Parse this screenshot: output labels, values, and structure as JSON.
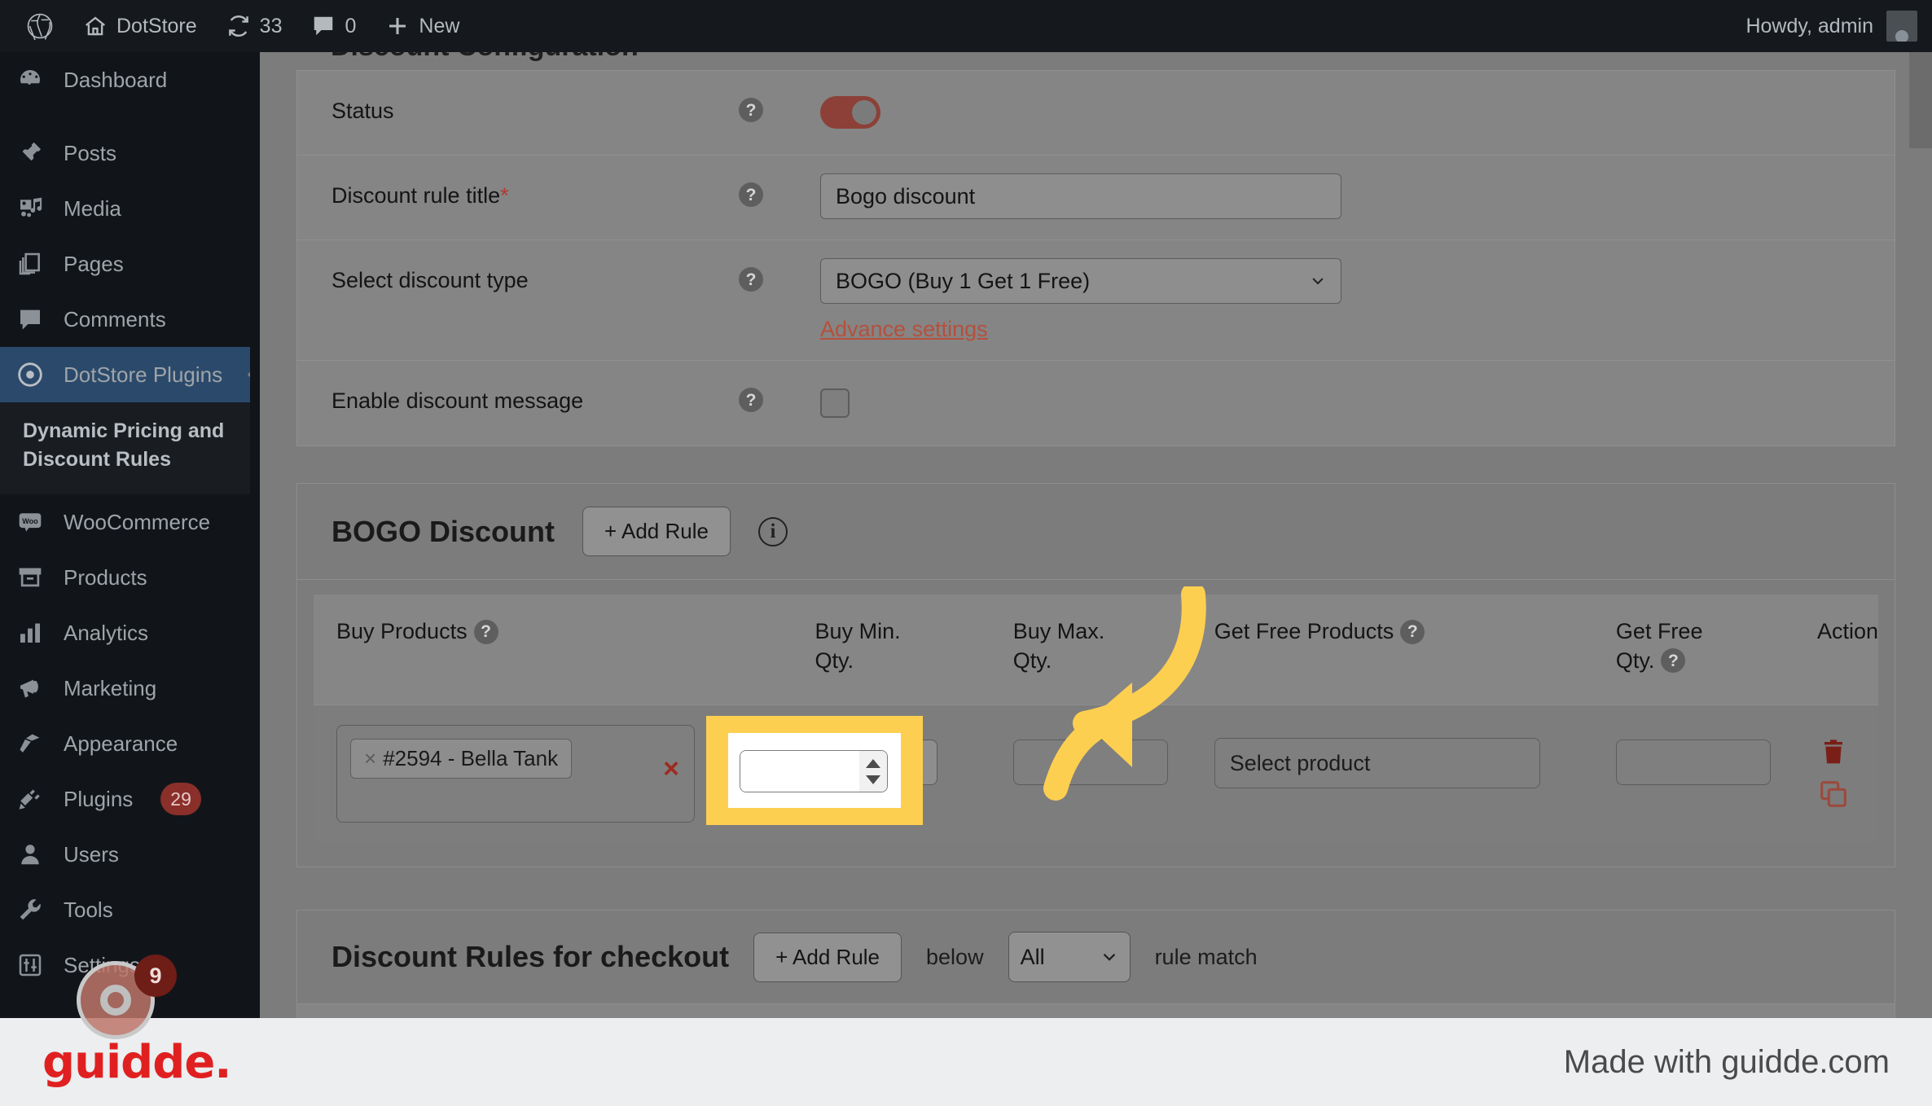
{
  "adminbar": {
    "items": [
      {
        "icon": "wordpress-icon",
        "label": ""
      },
      {
        "icon": "home-icon",
        "label": "DotStore"
      },
      {
        "icon": "updates-icon",
        "label": "33"
      },
      {
        "icon": "comment-icon",
        "label": "0"
      },
      {
        "icon": "plus-icon",
        "label": "New"
      }
    ],
    "howdy": "Howdy, admin"
  },
  "sidebar": {
    "items": [
      {
        "label": "Dashboard",
        "icon": "dashboard-icon",
        "badge": ""
      },
      {
        "label": "Posts",
        "icon": "pin-icon",
        "badge": ""
      },
      {
        "label": "Media",
        "icon": "media-icon",
        "badge": ""
      },
      {
        "label": "Pages",
        "icon": "pages-icon",
        "badge": ""
      },
      {
        "label": "Comments",
        "icon": "comment-icon",
        "badge": ""
      },
      {
        "label": "DotStore Plugins",
        "icon": "dotstore-icon",
        "badge": ""
      }
    ],
    "submenu_title": "Dynamic Pricing and Discount Rules",
    "items2": [
      {
        "label": "WooCommerce",
        "icon": "woo-icon",
        "badge": ""
      },
      {
        "label": "Products",
        "icon": "products-icon",
        "badge": ""
      },
      {
        "label": "Analytics",
        "icon": "analytics-icon",
        "badge": ""
      },
      {
        "label": "Marketing",
        "icon": "marketing-icon",
        "badge": ""
      },
      {
        "label": "Appearance",
        "icon": "appearance-icon",
        "badge": ""
      },
      {
        "label": "Plugins",
        "icon": "plugins-icon",
        "badge": "29"
      },
      {
        "label": "Users",
        "icon": "users-icon",
        "badge": ""
      },
      {
        "label": "Tools",
        "icon": "tools-icon",
        "badge": ""
      },
      {
        "label": "Settings",
        "icon": "settings-icon",
        "badge": ""
      }
    ]
  },
  "config": {
    "section_title": "Discount Configuration",
    "rows": {
      "status_label": "Status",
      "title_label": "Discount rule title",
      "title_required": "*",
      "title_value": "Bogo discount",
      "type_label": "Select discount type",
      "type_value": "BOGO (Buy 1 Get 1 Free)",
      "advance_settings": "Advance settings",
      "message_label": "Enable discount message"
    }
  },
  "bogo": {
    "title": "BOGO Discount",
    "add_rule": "+ Add Rule",
    "columns": [
      "Buy Products",
      "Buy Min. Qty.",
      "Buy Max. Qty.",
      "Get Free Products",
      "Get Free Qty.",
      "Action"
    ],
    "columns_split": [
      {
        "l1": "Buy Products",
        "l2": "",
        "help": true
      },
      {
        "l1": "Buy Min.",
        "l2": "Qty.",
        "help": false
      },
      {
        "l1": "Buy Max.",
        "l2": "Qty.",
        "help": false
      },
      {
        "l1": "Get Free Products",
        "l2": "",
        "help": true
      },
      {
        "l1": "Get Free",
        "l2": "Qty.",
        "help": true
      },
      {
        "l1": "Action",
        "l2": "",
        "help": false
      }
    ],
    "row": {
      "buy_product_token": "#2594 - Bella Tank",
      "token_remove": "×",
      "clear_all": "×",
      "buy_min_qty": "",
      "buy_max_qty": "",
      "get_free_products_placeholder": "Select product",
      "get_free_qty": ""
    }
  },
  "checkout": {
    "title": "Discount Rules for checkout",
    "add_rule": "+ Add Rule",
    "below_label": "below",
    "match_value": "All",
    "match_suffix": "rule match"
  },
  "cursor": {
    "badge": "9"
  },
  "footer": {
    "logo": "guidde.",
    "made_with": "Made with guidde.com"
  },
  "colors": {
    "accent_red": "#b5503d",
    "highlight_yellow": "#fdcf50",
    "sidebar_bg": "#11151a",
    "active_item": "#2b4a6b",
    "overlay_gray": "#7c7c7c"
  }
}
